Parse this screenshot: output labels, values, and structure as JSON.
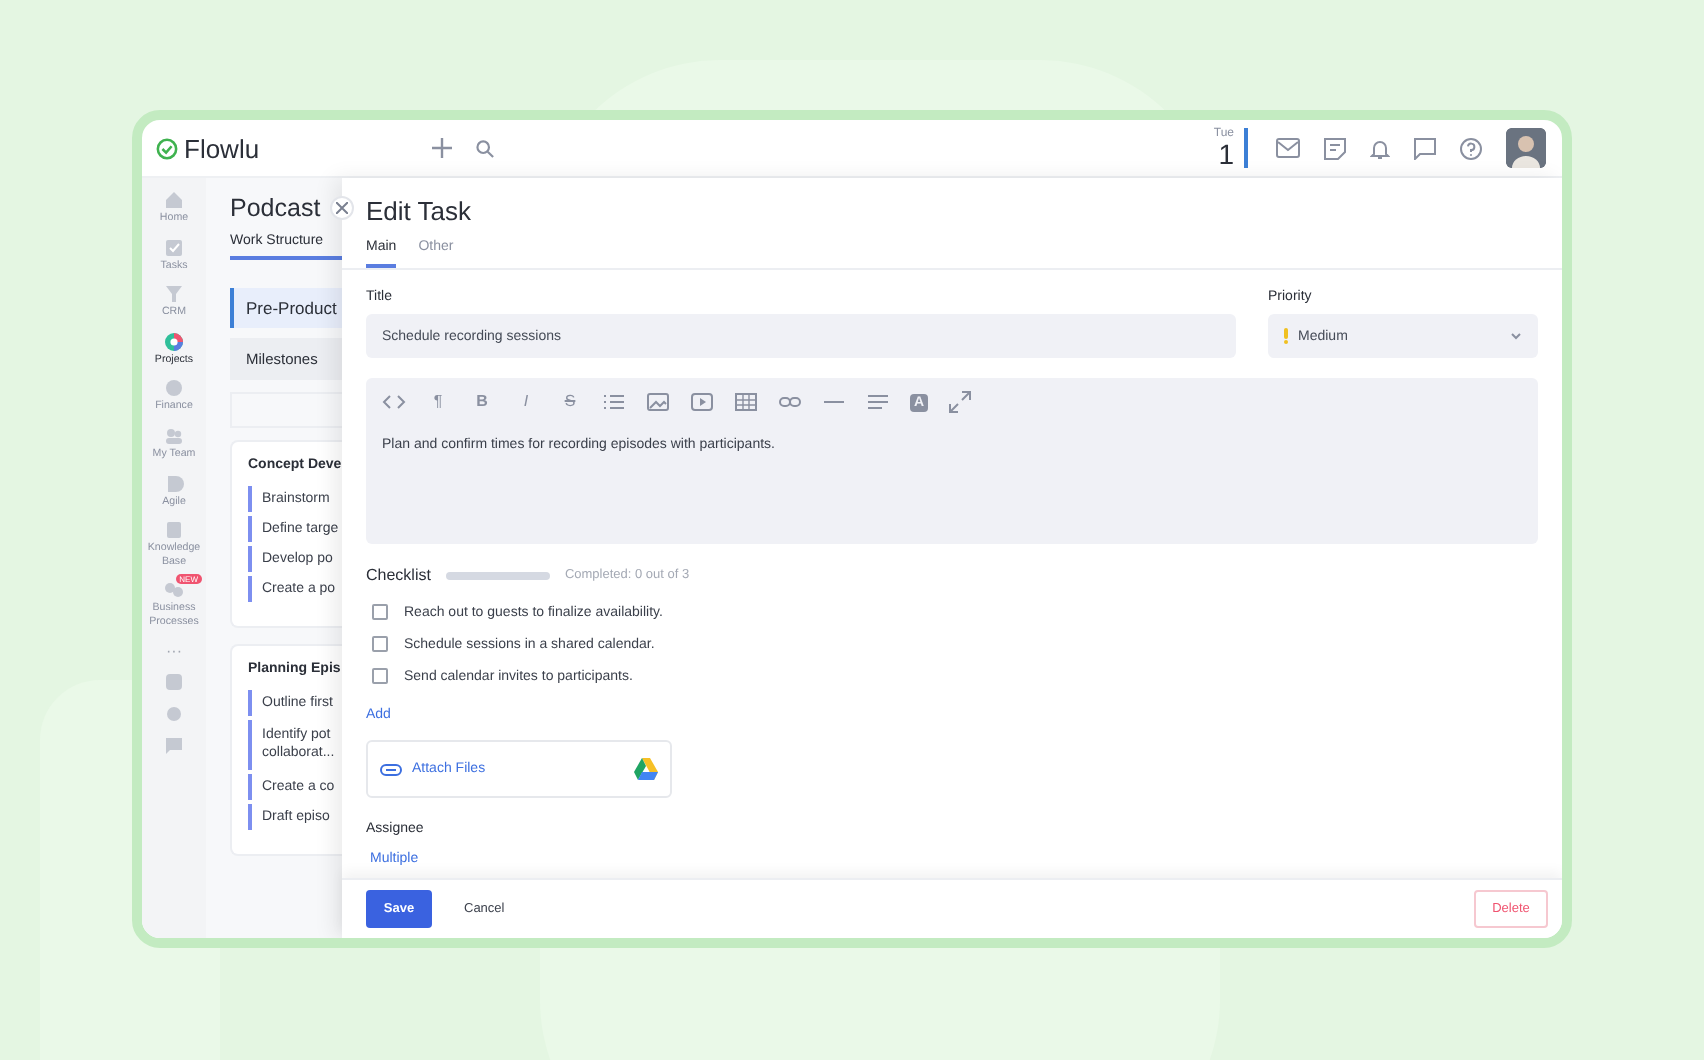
{
  "top_bar": {
    "logo": "Flowlu",
    "date": {
      "weekday": "Tue",
      "day": "1"
    }
  },
  "nav": [
    {
      "label": "Home",
      "selected": false
    },
    {
      "label": "Tasks",
      "selected": false
    },
    {
      "label": "CRM",
      "selected": false
    },
    {
      "label": "Projects",
      "selected": true
    },
    {
      "label": "Finance",
      "selected": false
    },
    {
      "label": "My Team",
      "selected": false
    },
    {
      "label": "Agile",
      "selected": false
    },
    {
      "label": "Knowledge Base",
      "selected": false
    },
    {
      "label": "Business Processes",
      "selected": false,
      "badge": "NEW"
    }
  ],
  "nav_more": "···",
  "project": {
    "title": "Podcast",
    "tab": "Work Structure",
    "stage": "Pre-Product",
    "milestones": "Milestones",
    "groups": [
      {
        "title": "Concept Deve",
        "tasks": [
          "Brainstorm",
          "Define targe",
          "Develop po",
          "Create a po"
        ]
      },
      {
        "title": "Planning Epis",
        "tasks": [
          "Outline first",
          "Identify pot collaborat...",
          "Create a co",
          "Draft episo"
        ]
      }
    ]
  },
  "edit_task": {
    "title": "Edit Task",
    "tabs": [
      {
        "label": "Main",
        "selected": true
      },
      {
        "label": "Other",
        "selected": false
      }
    ],
    "title_label": "Title",
    "title_value": "Schedule recording sessions",
    "priority_label": "Priority",
    "priority_value": "Medium",
    "toolbar": [
      {
        "kind": "code"
      },
      {
        "kind": "paragraph",
        "text": "¶"
      },
      {
        "kind": "bold",
        "text": "B"
      },
      {
        "kind": "italic",
        "text": "I"
      },
      {
        "kind": "strike",
        "text": "S"
      },
      {
        "kind": "list"
      },
      {
        "kind": "image"
      },
      {
        "kind": "video"
      },
      {
        "kind": "table"
      },
      {
        "kind": "link"
      },
      {
        "kind": "rule"
      },
      {
        "kind": "align"
      },
      {
        "kind": "highlight",
        "text": "A"
      },
      {
        "kind": "expand"
      }
    ],
    "description": "Plan and confirm times for recording episodes with participants.",
    "checklist": {
      "label": "Checklist",
      "level": 0,
      "summary": "Completed: 0 out of 3",
      "items": [
        {
          "text": "Reach out to guests to finalize availability.",
          "checked": false
        },
        {
          "text": "Schedule sessions in a shared calendar.",
          "checked": false
        },
        {
          "text": "Send calendar invites to participants.",
          "checked": false
        }
      ],
      "add": "Add"
    },
    "attach": "Attach Files",
    "assignee_label": "Assignee",
    "assignee_value": "Multiple",
    "buttons": {
      "save": "Save",
      "cancel": "Cancel",
      "delete": "Delete"
    }
  }
}
